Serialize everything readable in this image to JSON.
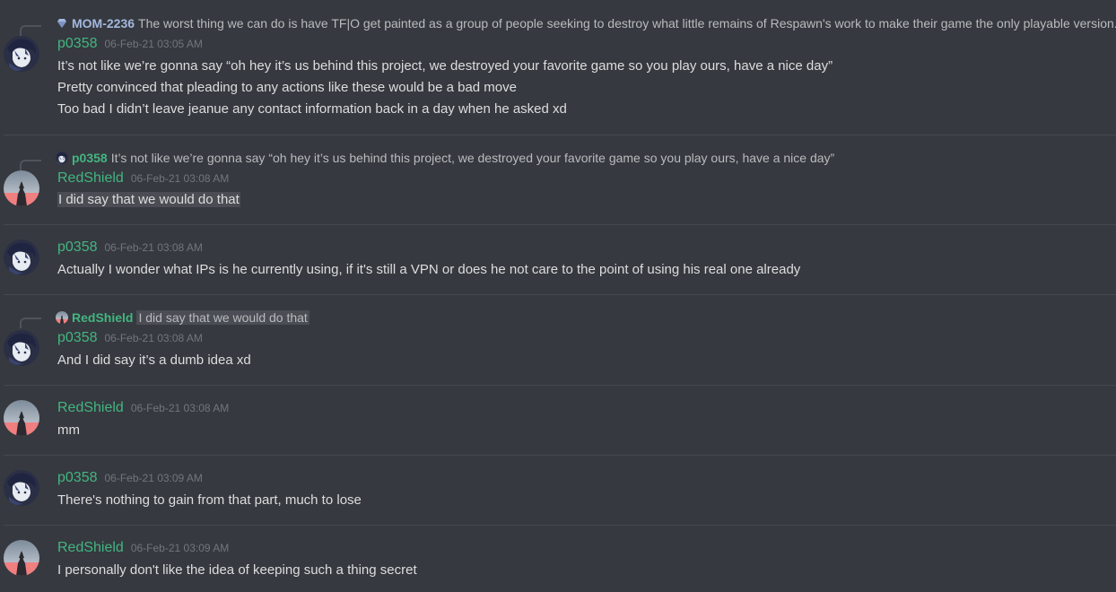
{
  "messages": [
    {
      "reply": {
        "name": "MOM-2236",
        "text": "The worst thing we can do is have TF|O get painted as a group of people seeking to destroy what little remains of Respawn's work to make their game the only playable version."
      },
      "author": "p0358",
      "timestamp": "06-Feb-21 03:05 AM",
      "lines": [
        "It’s not like we’re gonna say “oh hey it’s us behind this project, we destroyed your favorite game so you play ours, have a nice day”",
        "Pretty convinced that pleading to any actions like these would be a bad move",
        "Too bad I didn’t leave jeanue any contact information back in a day when he asked xd"
      ]
    },
    {
      "reply": {
        "name": "p0358",
        "text": "It’s not like we’re gonna say “oh hey it’s us behind this project, we destroyed your favorite game so you play ours, have a nice day”"
      },
      "author": "RedShield",
      "timestamp": "06-Feb-21 03:08 AM",
      "lines": [
        "I did say that we would do that"
      ]
    },
    {
      "author": "p0358",
      "timestamp": "06-Feb-21 03:08 AM",
      "lines": [
        "Actually I wonder what IPs is he currently using, if it's still a VPN or does he not care to the point of using his real one already"
      ]
    },
    {
      "reply": {
        "name": "RedShield",
        "text": "I did say that we would do that"
      },
      "author": "p0358",
      "timestamp": "06-Feb-21 03:08 AM",
      "lines": [
        "And I did say it’s a dumb idea xd"
      ]
    },
    {
      "author": "RedShield",
      "timestamp": "06-Feb-21 03:08 AM",
      "lines": [
        "mm"
      ]
    },
    {
      "author": "p0358",
      "timestamp": "06-Feb-21 03:09 AM",
      "lines": [
        "There's nothing to gain from that part, much to lose"
      ]
    },
    {
      "author": "RedShield",
      "timestamp": "06-Feb-21 03:09 AM",
      "lines": [
        "I personally don't like the idea of keeping such a thing secret"
      ]
    }
  ],
  "colors": {
    "background": "#36393f",
    "username": "#43b581",
    "timestamp": "#72767d",
    "text": "#dcddde",
    "reply_mom": "#a3b8de"
  },
  "icons": {
    "p0358_avatar": "anime-character-avatar",
    "redshield_avatar": "silhouette-on-gradient-avatar",
    "mom_avatar": "gem-icon"
  }
}
